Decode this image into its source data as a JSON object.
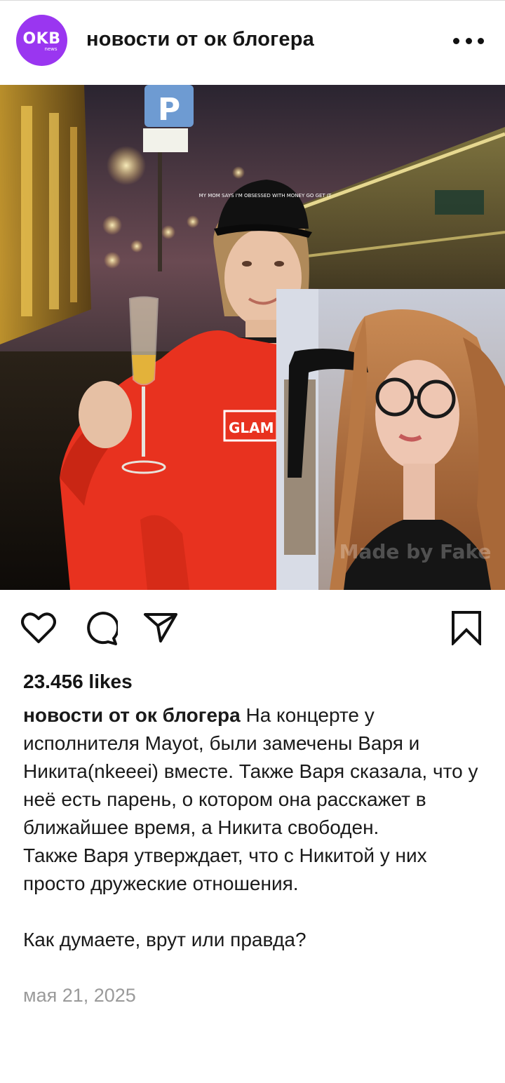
{
  "header": {
    "avatar_text": "OKB",
    "avatar_subtext": "news",
    "account_name": "новости от ок блогера",
    "more_icon": "more-dots-icon"
  },
  "photo": {
    "left_cap_text": "MY MOM SAYS I'M OBSESSED WITH MONEY GO GET IT",
    "hoodie_text": "GLAM",
    "sign_text": "P",
    "watermark": "Made by Fake"
  },
  "actions": {
    "like_icon": "heart-icon",
    "comment_icon": "comment-icon",
    "share_icon": "send-icon",
    "save_icon": "bookmark-icon"
  },
  "post": {
    "likes": "23.456 likes",
    "author": "новости от ок блогера",
    "caption": " На концерте у исполнителя Mayot, были замечены Варя и Никита(nkeeei) вместе. Также Варя сказала, что у неё есть парень, о котором она расскажет в ближайшее время, а Никита свободен.\nТакже Варя утверждает, что с Никитой у них просто дружеские отношения.\n\nКак думаете, врут или правда?",
    "date": "мая 21, 2025"
  },
  "colors": {
    "avatar_bg": "#9a36f0",
    "hoodie": "#e8321f",
    "date_text": "#9a9a9a"
  }
}
